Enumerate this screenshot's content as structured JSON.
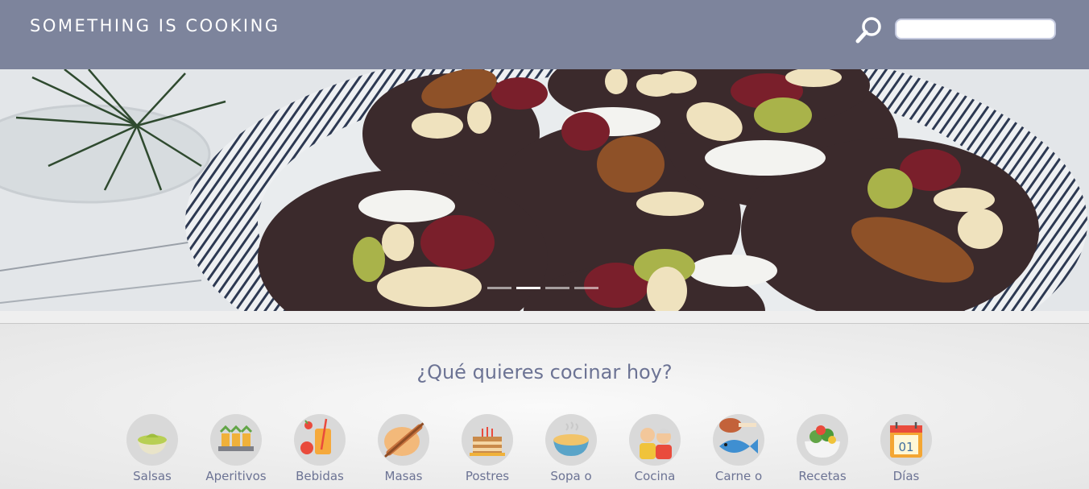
{
  "header": {
    "brand": "SOMETHING IS COOKING",
    "search_icon": "search-icon",
    "search_value": "",
    "search_placeholder": ""
  },
  "hero": {
    "image": "chocolate-mendiants-with-nuts",
    "slide_count": 4,
    "active_slide": 2
  },
  "main": {
    "question": "¿Qué quieres cocinar hoy?",
    "categories": [
      {
        "label": "Salsas",
        "icon": "sauce-bowl-icon"
      },
      {
        "label": "Aperitivos",
        "icon": "appetizer-tray-icon"
      },
      {
        "label": "Bebidas",
        "icon": "drink-icon"
      },
      {
        "label": "Masas",
        "icon": "dough-rolling-pin-icon"
      },
      {
        "label": "Postres",
        "icon": "cake-icon"
      },
      {
        "label": "Sopa o",
        "icon": "soup-bowl-icon"
      },
      {
        "label": "Cocina",
        "icon": "grandparents-icon"
      },
      {
        "label": "Carne o",
        "icon": "meat-fish-icon"
      },
      {
        "label": "Recetas",
        "icon": "salad-bowl-icon"
      },
      {
        "label": "Días",
        "icon": "calendar-icon"
      }
    ],
    "calendar_number": "01"
  },
  "colors": {
    "header": "#7d849c",
    "text_accent": "#6c7394",
    "background": "#efefef"
  }
}
